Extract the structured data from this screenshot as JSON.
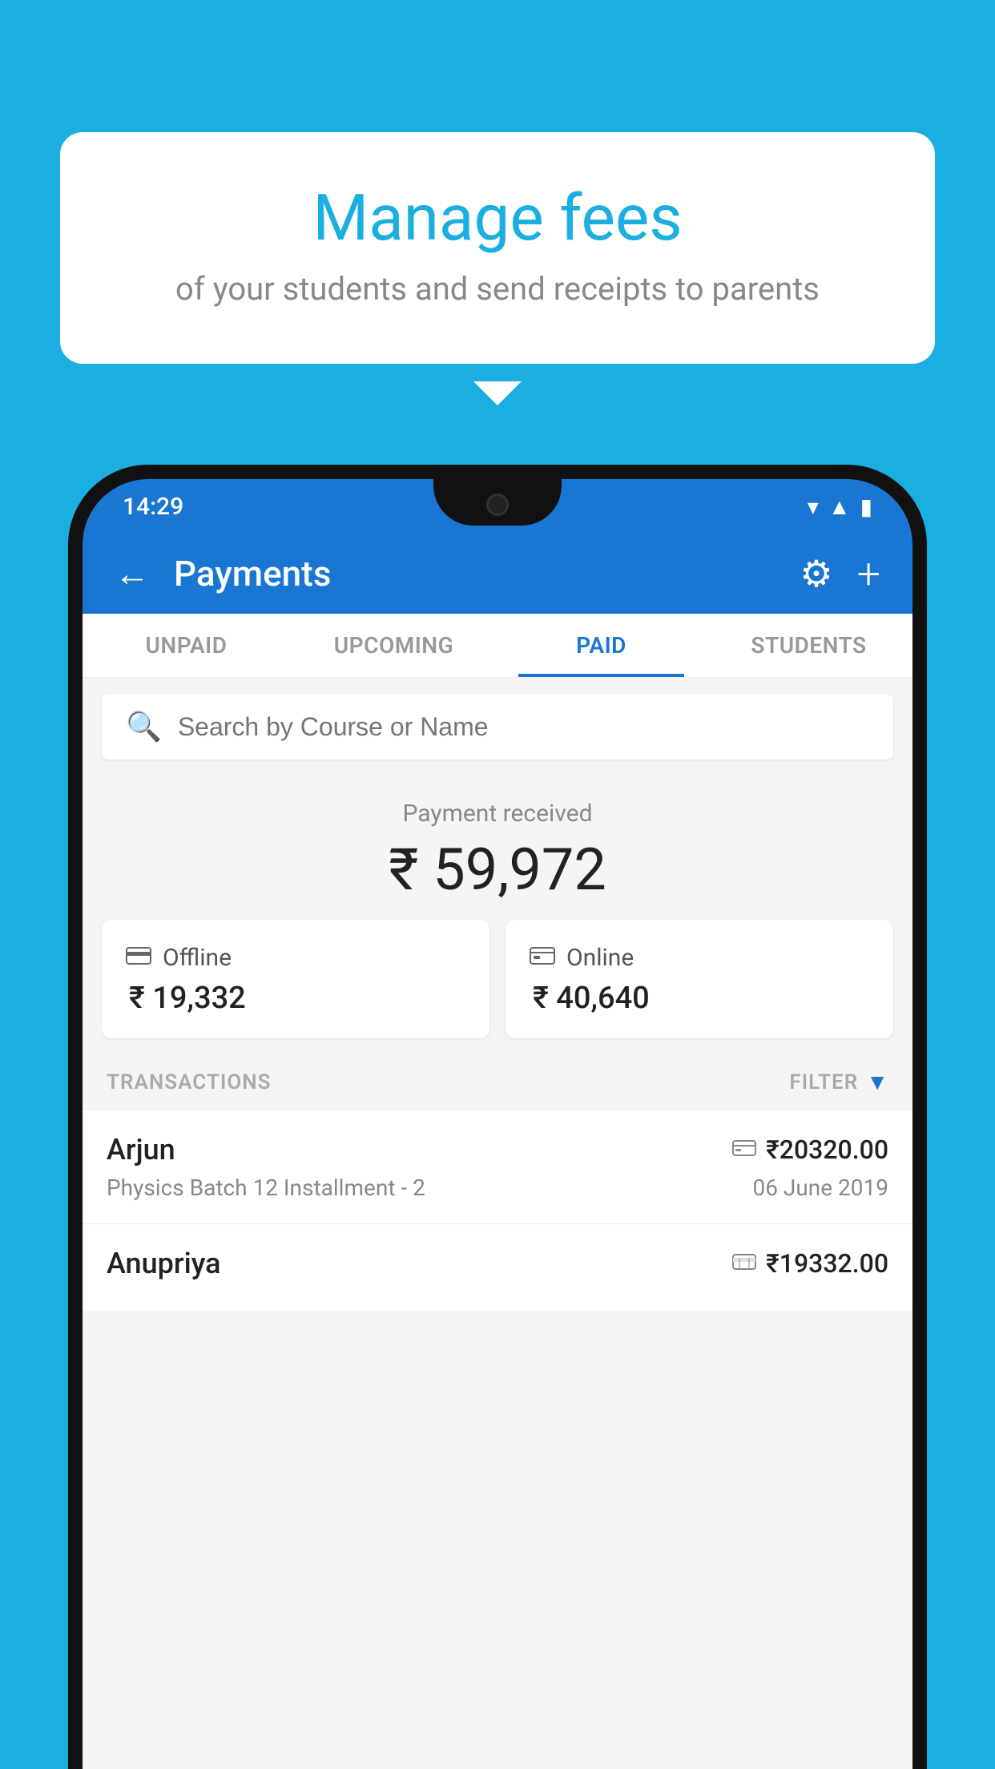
{
  "background_color": "#1AAFE0",
  "bubble": {
    "title": "Manage fees",
    "subtitle": "of your students and send receipts to parents"
  },
  "status_bar": {
    "time": "14:29"
  },
  "header": {
    "title": "Payments",
    "back_label": "←",
    "plus_label": "+"
  },
  "tabs": [
    {
      "id": "unpaid",
      "label": "UNPAID",
      "active": false
    },
    {
      "id": "upcoming",
      "label": "UPCOMING",
      "active": false
    },
    {
      "id": "paid",
      "label": "PAID",
      "active": true
    },
    {
      "id": "students",
      "label": "STUDENTS",
      "active": false
    }
  ],
  "search": {
    "placeholder": "Search by Course or Name"
  },
  "payment_summary": {
    "label": "Payment received",
    "amount": "₹ 59,972"
  },
  "payment_cards": [
    {
      "id": "offline",
      "icon": "💳",
      "label": "Offline",
      "amount": "₹ 19,332"
    },
    {
      "id": "online",
      "icon": "💳",
      "label": "Online",
      "amount": "₹ 40,640"
    }
  ],
  "transactions_label": "TRANSACTIONS",
  "filter_label": "FILTER",
  "transactions": [
    {
      "name": "Arjun",
      "type_icon": "💳",
      "amount": "₹20320.00",
      "course": "Physics Batch 12 Installment - 2",
      "date": "06 June 2019"
    },
    {
      "name": "Anupriya",
      "type_icon": "💵",
      "amount": "₹19332.00",
      "course": "",
      "date": ""
    }
  ]
}
